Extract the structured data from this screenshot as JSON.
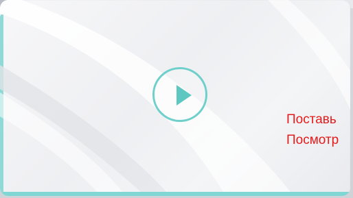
{
  "video_card": {
    "play_icon": "play-icon",
    "caption_lines": [
      "Поставь",
      "Посмотр"
    ]
  },
  "colors": {
    "accent_teal": "#6fcfca",
    "caption_red": "#e41b1b",
    "card_background": "#f2f3f5"
  }
}
